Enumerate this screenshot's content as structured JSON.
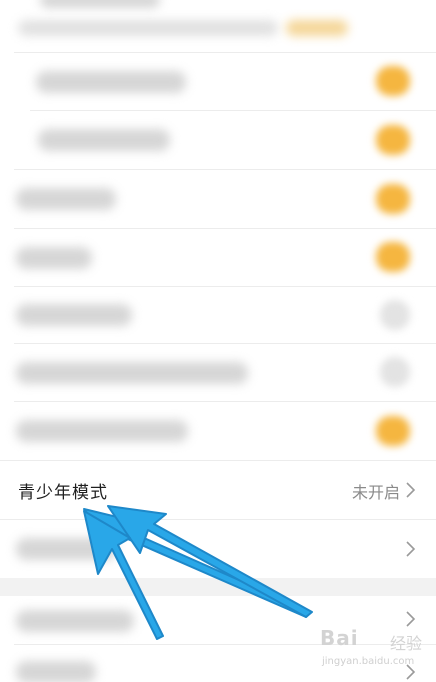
{
  "settings": {
    "teen_mode": {
      "label": "青少年模式",
      "status": "未开启"
    }
  },
  "colors": {
    "toggle_on": "#f5b640",
    "arrow_fill": "#29a7e8",
    "arrow_stroke": "#1e88c9"
  },
  "icons": {
    "chevron": "chevron-right-icon"
  },
  "watermark": {
    "brand": "Bai",
    "sub": "经验",
    "url": "jingyan.baidu.com"
  }
}
